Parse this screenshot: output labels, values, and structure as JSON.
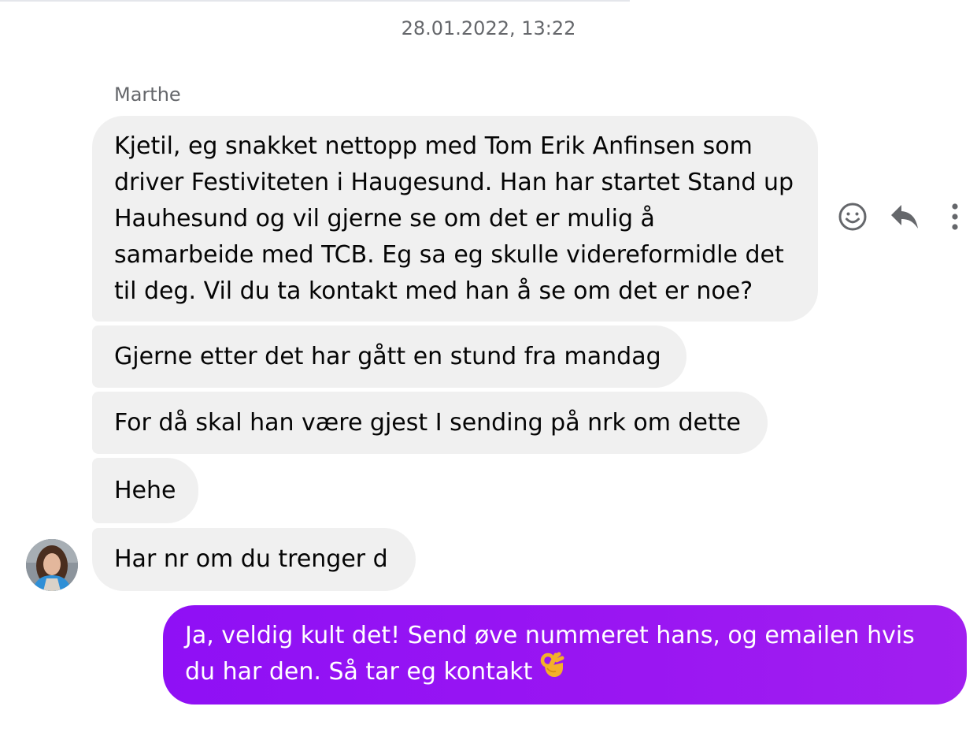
{
  "thread": {
    "timestamp": "28.01.2022, 13:22",
    "sender_name": "Marthe"
  },
  "messages": [
    {
      "lines": [
        "Kjetil, eg snakket nettopp med Tom Erik Anfinsen som",
        "driver Festiviteten i Haugesund. Han har startet Stand up",
        "Hauhesund og vil gjerne se om det er mulig å",
        "samarbeide med TCB. Eg sa eg skulle videreformidle det",
        "til deg. Vil du ta kontakt med han å se om det er noe?"
      ]
    },
    {
      "text": "Gjerne etter det har gått en stund fra mandag"
    },
    {
      "text": "For då skal han være gjest I sending på nrk om dette"
    },
    {
      "text": "Hehe"
    },
    {
      "text": "Har nr om du trenger d"
    }
  ],
  "own_message": {
    "lines": [
      "Ja, veldig kult det! Send øve nummeret hans, og emailen hvis",
      "du har den. Så tar eg kontakt"
    ],
    "emoji": "ok-hand-emoji"
  },
  "actions": {
    "icons": [
      "smiley-icon",
      "reply-icon",
      "more-options-icon"
    ]
  },
  "colors": {
    "incoming_bubble": "#f0f0f0",
    "outgoing_bubble": "#9a16f2",
    "meta_text": "#65676b"
  }
}
